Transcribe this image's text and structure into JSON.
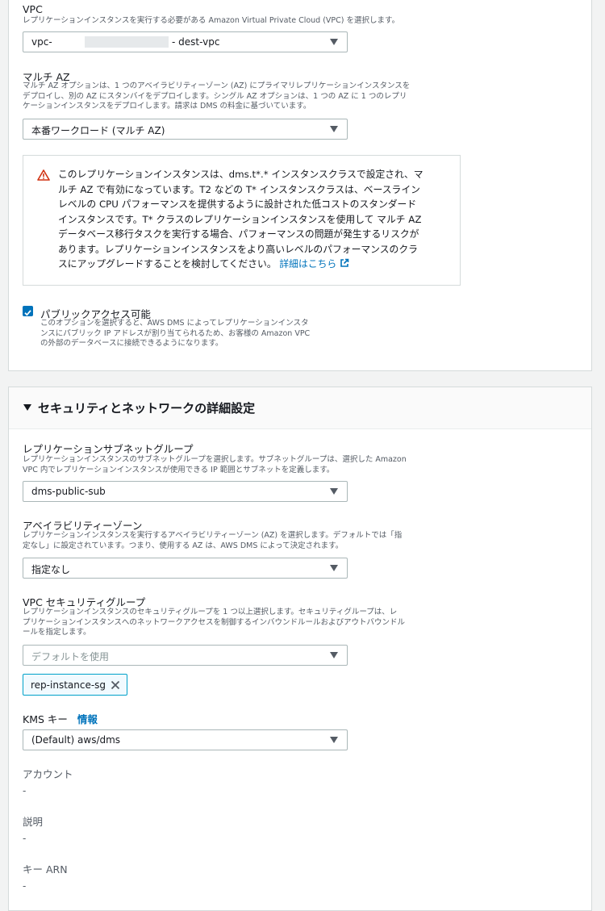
{
  "vpc": {
    "label": "VPC",
    "description": "レプリケーションインスタンスを実行する必要がある Amazon Virtual Private Cloud (VPC) を選択します。",
    "value_prefix": "vpc-",
    "value_suffix": "- dest-vpc"
  },
  "multi_az": {
    "label": "マルチ AZ",
    "description_lines": [
      "マルチ AZ オプションは、1 つのアベイラビリティーゾーン (AZ) にプライマリレプリケーションインスタンスを",
      "デプロイし、別の AZ にスタンバイをデプロイします。シングル AZ オプションは、1 つの AZ に 1 つのレプリ",
      "ケーションインスタンスをデプロイします。請求は DMS の料金に基づいています。"
    ],
    "value": "本番ワークロード (マルチ AZ)"
  },
  "warning": {
    "lines": [
      "このレプリケーションインスタンスは、dms.t*.* インスタンスクラスで設定され、マ",
      "ルチ AZ で有効になっています。T2 などの T* インスタンスクラスは、ベースライン",
      "レベルの CPU パフォーマンスを提供するように設計された低コストのスタンダード",
      "インスタンスです。T* クラスのレプリケーションインスタンスを使用して マルチ AZ",
      "データベース移行タスクを実行する場合、パフォーマンスの問題が発生するリスクが",
      "あります。レプリケーションインスタンスをより高いレベルのパフォーマンスのクラ",
      "スにアップグレードすることを検討してください。"
    ],
    "link": "詳細はこちら",
    "accent_color": "#d13212"
  },
  "public_access": {
    "label": "パブリックアクセス可能",
    "checked": true,
    "description_lines": [
      "このオプションを選択すると、AWS DMS によってレプリケーションインスタ",
      "ンスにパブリック IP アドレスが割り当てられるため、お客様の Amazon VPC",
      "の外部のデータベースに接続できるようになります。"
    ]
  },
  "security_section": {
    "title": "セキュリティとネットワークの詳細設定"
  },
  "subnet_group": {
    "label": "レプリケーションサブネットグループ",
    "description_lines": [
      "レプリケーションインスタンスのサブネットグループを選択します。サブネットグループは、選択した Amazon",
      "VPC 内でレプリケーションインスタンスが使用できる IP 範囲とサブネットを定義します。"
    ],
    "value": "dms-public-sub"
  },
  "availability_zone": {
    "label": "アベイラビリティーゾーン",
    "description_lines": [
      "レプリケーションインスタンスを実行するアベイラビリティーゾーン (AZ) を選択します。デフォルトでは「指",
      "定なし」に設定されています。つまり、使用する AZ は、AWS DMS によって決定されます。"
    ],
    "value": "指定なし"
  },
  "vpc_security_group": {
    "label": "VPC セキュリティグループ",
    "description_lines": [
      "レプリケーションインスタンスのセキュリティグループを 1 つ以上選択します。セキュリティグループは、レ",
      "プリケーションインスタンスへのネットワークアクセスを制御するインバウンドルールおよびアウトバウンドル",
      "ールを指定します。"
    ],
    "placeholder": "デフォルトを使用",
    "token": "rep-instance-sg"
  },
  "kms_key": {
    "label": "KMS キー",
    "info_link": "情報",
    "value": "(Default) aws/dms"
  },
  "account": {
    "label": "アカウント",
    "value": "-"
  },
  "description_field": {
    "label": "説明",
    "value": "-"
  },
  "key_arn": {
    "label": "キー ARN",
    "value": "-"
  },
  "colors": {
    "link": "#0073bb",
    "checkbox": "#0073bb",
    "token_border": "#00a1c9"
  }
}
